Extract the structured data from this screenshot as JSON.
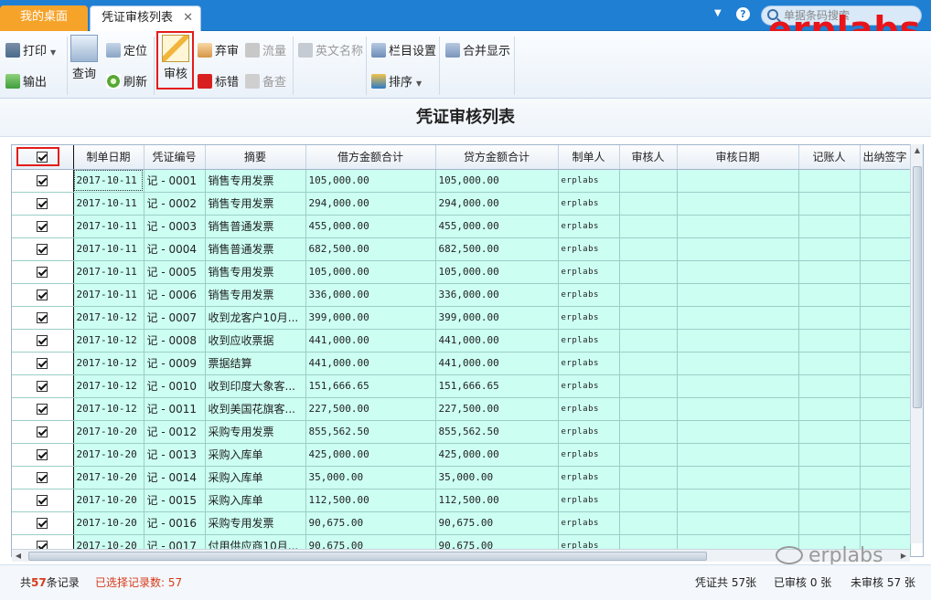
{
  "tabs": {
    "home": "我的桌面",
    "active": "凭证审核列表",
    "close": "✕"
  },
  "topbar": {
    "dropdown": "▼",
    "help": "?",
    "search_placeholder": "单据条码搜索"
  },
  "watermark": "erplabs",
  "toolbar": {
    "print": "打印",
    "export": "输出",
    "query": "查询",
    "locate": "定位",
    "refresh": "刷新",
    "audit": "审核",
    "discard_audit": "弃审",
    "flag_error": "标错",
    "flow": "流量",
    "memo": "备查",
    "english_name": "英文名称",
    "column_settings": "栏目设置",
    "sort": "排序",
    "merge_display": "合并显示"
  },
  "title": "凭证审核列表",
  "columns": [
    "制单日期",
    "凭证编号",
    "摘要",
    "借方金额合计",
    "贷方金额合计",
    "制单人",
    "审核人",
    "审核日期",
    "记账人",
    "出纳签字"
  ],
  "rows": [
    {
      "date": "2017-10-11",
      "no": "记 - 0001",
      "summary": "销售专用发票",
      "debit": "105,000.00",
      "credit": "105,000.00",
      "maker": "erplabs"
    },
    {
      "date": "2017-10-11",
      "no": "记 - 0002",
      "summary": "销售专用发票",
      "debit": "294,000.00",
      "credit": "294,000.00",
      "maker": "erplabs"
    },
    {
      "date": "2017-10-11",
      "no": "记 - 0003",
      "summary": "销售普通发票",
      "debit": "455,000.00",
      "credit": "455,000.00",
      "maker": "erplabs"
    },
    {
      "date": "2017-10-11",
      "no": "记 - 0004",
      "summary": "销售普通发票",
      "debit": "682,500.00",
      "credit": "682,500.00",
      "maker": "erplabs"
    },
    {
      "date": "2017-10-11",
      "no": "记 - 0005",
      "summary": "销售专用发票",
      "debit": "105,000.00",
      "credit": "105,000.00",
      "maker": "erplabs"
    },
    {
      "date": "2017-10-11",
      "no": "记 - 0006",
      "summary": "销售专用发票",
      "debit": "336,000.00",
      "credit": "336,000.00",
      "maker": "erplabs"
    },
    {
      "date": "2017-10-12",
      "no": "记 - 0007",
      "summary": "收到龙客户10月...",
      "debit": "399,000.00",
      "credit": "399,000.00",
      "maker": "erplabs"
    },
    {
      "date": "2017-10-12",
      "no": "记 - 0008",
      "summary": "收到应收票据",
      "debit": "441,000.00",
      "credit": "441,000.00",
      "maker": "erplabs"
    },
    {
      "date": "2017-10-12",
      "no": "记 - 0009",
      "summary": "票据结算",
      "debit": "441,000.00",
      "credit": "441,000.00",
      "maker": "erplabs"
    },
    {
      "date": "2017-10-12",
      "no": "记 - 0010",
      "summary": "收到印度大象客...",
      "debit": "151,666.65",
      "credit": "151,666.65",
      "maker": "erplabs"
    },
    {
      "date": "2017-10-12",
      "no": "记 - 0011",
      "summary": "收到美国花旗客...",
      "debit": "227,500.00",
      "credit": "227,500.00",
      "maker": "erplabs"
    },
    {
      "date": "2017-10-20",
      "no": "记 - 0012",
      "summary": "采购专用发票",
      "debit": "855,562.50",
      "credit": "855,562.50",
      "maker": "erplabs"
    },
    {
      "date": "2017-10-20",
      "no": "记 - 0013",
      "summary": "采购入库单",
      "debit": "425,000.00",
      "credit": "425,000.00",
      "maker": "erplabs"
    },
    {
      "date": "2017-10-20",
      "no": "记 - 0014",
      "summary": "采购入库单",
      "debit": "35,000.00",
      "credit": "35,000.00",
      "maker": "erplabs"
    },
    {
      "date": "2017-10-20",
      "no": "记 - 0015",
      "summary": "采购入库单",
      "debit": "112,500.00",
      "credit": "112,500.00",
      "maker": "erplabs"
    },
    {
      "date": "2017-10-20",
      "no": "记 - 0016",
      "summary": "采购专用发票",
      "debit": "90,675.00",
      "credit": "90,675.00",
      "maker": "erplabs"
    },
    {
      "date": "2017-10-20",
      "no": "记 - 0017",
      "summary": "付用供应商10月...",
      "debit": "90,675.00",
      "credit": "90,675.00",
      "maker": "erplabs"
    }
  ],
  "status": {
    "total_prefix": "共",
    "total_count": "57",
    "total_suffix": "条记录",
    "selected": "已选择记录数: 57",
    "voucher_total": "凭证共 57张",
    "audited": "已审核 0 张",
    "unaudited": "未审核 57 张"
  },
  "wechat_watermark": "erplabs"
}
